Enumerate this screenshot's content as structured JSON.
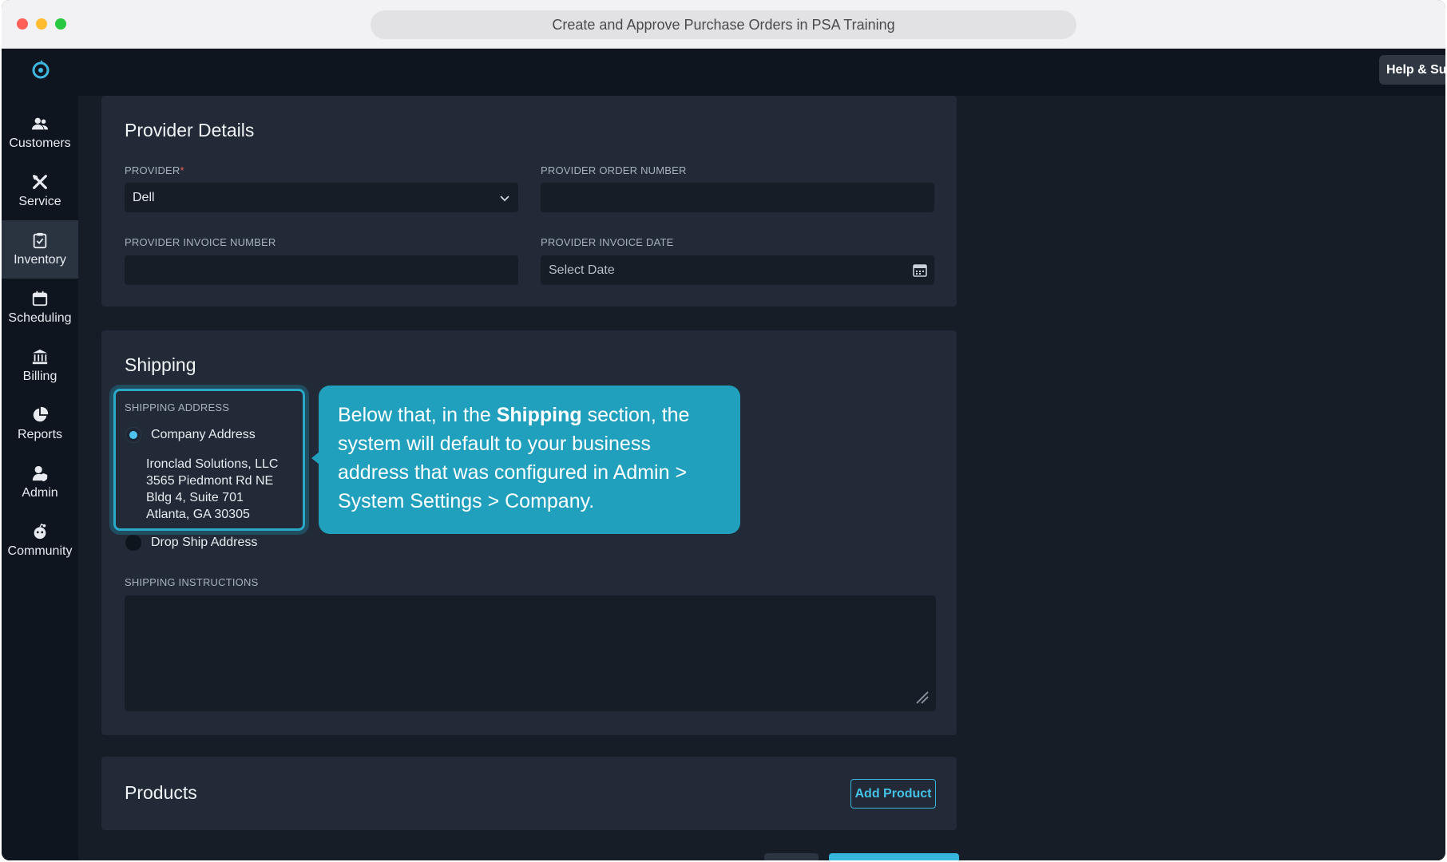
{
  "browser": {
    "title": "Create and Approve Purchase Orders in PSA Training"
  },
  "topnav": {
    "help_label": "Help & Sup"
  },
  "sidebar": {
    "items": [
      {
        "label": "Customers",
        "icon": "users-icon"
      },
      {
        "label": "Service",
        "icon": "tools-icon"
      },
      {
        "label": "Inventory",
        "icon": "clipboard-icon",
        "active": true
      },
      {
        "label": "Scheduling",
        "icon": "calendar-icon"
      },
      {
        "label": "Billing",
        "icon": "bank-icon"
      },
      {
        "label": "Reports",
        "icon": "pie-chart-icon"
      },
      {
        "label": "Admin",
        "icon": "user-shield-icon"
      },
      {
        "label": "Community",
        "icon": "community-icon"
      }
    ]
  },
  "provider_details": {
    "title": "Provider Details",
    "provider_label": "PROVIDER",
    "required_mark": "*",
    "provider_value": "Dell",
    "order_number_label": "PROVIDER ORDER NUMBER",
    "order_number_value": "",
    "invoice_number_label": "PROVIDER INVOICE NUMBER",
    "invoice_number_value": "",
    "invoice_date_label": "PROVIDER INVOICE DATE",
    "invoice_date_placeholder": "Select Date"
  },
  "shipping": {
    "title": "Shipping",
    "address_label": "SHIPPING ADDRESS",
    "company_address_label": "Company Address",
    "company_address_selected": true,
    "address_lines": [
      "Ironclad Solutions, LLC",
      "3565 Piedmont Rd NE",
      "Bldg 4, Suite 701",
      "Atlanta, GA 30305"
    ],
    "drop_ship_label": "Drop Ship Address",
    "instructions_label": "SHIPPING INSTRUCTIONS",
    "instructions_value": ""
  },
  "callout": {
    "before": "Below that, in the ",
    "bold": "Shipping",
    "after": " section, the system will default to your business address that was configured in Admin > System Settings > Company."
  },
  "products": {
    "title": "Products",
    "add_label": "Add Product"
  },
  "colors": {
    "accent": "#21a0bd",
    "sidebar_bg": "#0e151e",
    "panel_bg": "#212a36",
    "page_bg": "#161d27"
  }
}
